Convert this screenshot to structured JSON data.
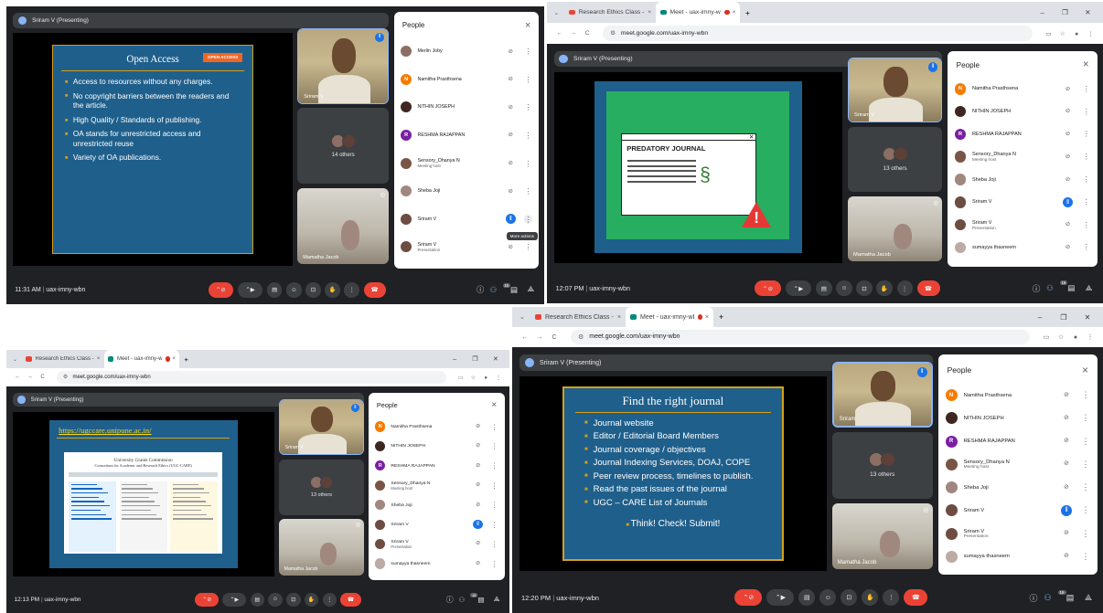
{
  "browser": {
    "tab_mail": "Research Ethics Class - mamo",
    "tab_meet": "Meet - uax-imny-wbn",
    "url": "meet.google.com/uax-imny-wbn",
    "close": "×",
    "new_tab": "+",
    "minimize": "–",
    "restore": "❐",
    "win_close": "✕",
    "back": "←",
    "forward": "→",
    "reload": "C",
    "tune": "⚙"
  },
  "meet": {
    "presenting": "Sriram V (Presenting)",
    "people_title": "People",
    "people_close": "×",
    "more_actions_tooltip": "More actions",
    "meeting_code": "uax-imny-wbn",
    "participant_count": "16"
  },
  "shots": [
    {
      "time": "11:31 AM",
      "slide": {
        "title": "Open Access",
        "logo_text": "OPEN ACCESS",
        "bullets": [
          "Access to resources without any charges.",
          "No copyright barriers between the readers and the article.",
          "High Quality / Standards of publishing.",
          "OA stands for unrestricted access and unrestricted reuse",
          "Variety of OA publications."
        ]
      },
      "tiles": {
        "speaker": "Sriram V",
        "others": "14 others",
        "third": "Mamatha Jacob"
      },
      "people": [
        {
          "name": "Merlin Joby",
          "sub": "",
          "initial": "",
          "color": "#8d6e63",
          "mic": "off"
        },
        {
          "name": "Namitha Prasthsena",
          "sub": "",
          "initial": "N",
          "color": "#f57c00",
          "mic": "off"
        },
        {
          "name": "NITHIN JOSEPH",
          "sub": "",
          "initial": "",
          "color": "#3e2723",
          "mic": "off"
        },
        {
          "name": "RESHMA RAJAPPAN",
          "sub": "",
          "initial": "R",
          "color": "#7b1fa2",
          "mic": "off"
        },
        {
          "name": "Sensory_Dhanya N",
          "sub": "Meeting host",
          "initial": "",
          "color": "#795548",
          "mic": "off"
        },
        {
          "name": "Sheba Joji",
          "sub": "",
          "initial": "",
          "color": "#a1887f",
          "mic": "off"
        },
        {
          "name": "Sriram V",
          "sub": "",
          "initial": "",
          "color": "#6d4c41",
          "mic": "on"
        },
        {
          "name": "Sriram V",
          "sub": "Presentation",
          "initial": "",
          "color": "#6d4c41",
          "mic": "off"
        }
      ]
    },
    {
      "time": "12:07 PM",
      "slide": {
        "title": "PREDATORY JOURNAL"
      },
      "tiles": {
        "speaker": "Sriram V",
        "others": "13 others",
        "third": "Mamatha Jacob"
      },
      "people": [
        {
          "name": "Namitha Prasthsena",
          "sub": "",
          "initial": "N",
          "color": "#f57c00",
          "mic": "off"
        },
        {
          "name": "NITHIN JOSEPH",
          "sub": "",
          "initial": "",
          "color": "#3e2723",
          "mic": "off"
        },
        {
          "name": "RESHMA RAJAPPAN",
          "sub": "",
          "initial": "R",
          "color": "#7b1fa2",
          "mic": "off"
        },
        {
          "name": "Sensory_Dhanya N",
          "sub": "Meeting host",
          "initial": "",
          "color": "#795548",
          "mic": "off"
        },
        {
          "name": "Sheba Joji",
          "sub": "",
          "initial": "",
          "color": "#a1887f",
          "mic": "off"
        },
        {
          "name": "Sriram V",
          "sub": "",
          "initial": "",
          "color": "#6d4c41",
          "mic": "on"
        },
        {
          "name": "Sriram V",
          "sub": "Presentation",
          "initial": "",
          "color": "#6d4c41",
          "mic": "off"
        },
        {
          "name": "sumayya thasneem",
          "sub": "",
          "initial": "",
          "color": "#bcaaa4",
          "mic": "off"
        }
      ]
    },
    {
      "time": "12:13 PM",
      "slide": {
        "title": "https://ugccare.unipune.ac.in/",
        "site_title": "University Grants Commission",
        "site_subtitle": "Consortium for Academic and Research Ethics (UGC-CARE)"
      },
      "tiles": {
        "speaker": "Sriram V",
        "others": "13 others",
        "third": "Mamatha Jacob"
      },
      "people": [
        {
          "name": "Namitha Prasthsena",
          "sub": "",
          "initial": "N",
          "color": "#f57c00",
          "mic": "off"
        },
        {
          "name": "NITHIN JOSEPH",
          "sub": "",
          "initial": "",
          "color": "#3e2723",
          "mic": "off"
        },
        {
          "name": "RESHMA RAJAPPAN",
          "sub": "",
          "initial": "R",
          "color": "#7b1fa2",
          "mic": "off"
        },
        {
          "name": "Sensory_Dhanya N",
          "sub": "Meeting host",
          "initial": "",
          "color": "#795548",
          "mic": "off"
        },
        {
          "name": "Sheba Joji",
          "sub": "",
          "initial": "",
          "color": "#a1887f",
          "mic": "off"
        },
        {
          "name": "Sriram V",
          "sub": "",
          "initial": "",
          "color": "#6d4c41",
          "mic": "on"
        },
        {
          "name": "Sriram V",
          "sub": "Presentation",
          "initial": "",
          "color": "#6d4c41",
          "mic": "off"
        },
        {
          "name": "sumayya thasneem",
          "sub": "",
          "initial": "",
          "color": "#bcaaa4",
          "mic": "off"
        }
      ]
    },
    {
      "time": "12:20 PM",
      "slide": {
        "title": "Find the right journal",
        "bullets": [
          "Journal website",
          "Editor / Editorial Board Members",
          "Journal coverage / objectives",
          "Journal Indexing Services, DOAJ, COPE",
          "Peer review process, timelines to publish.",
          "Read the past issues of the journal",
          "UGC – CARE List of Journals"
        ],
        "footer": "Think! Check! Submit!"
      },
      "tiles": {
        "speaker": "Sriram",
        "others": "13 others",
        "third": "Mamatha Jacob"
      },
      "people": [
        {
          "name": "Namitha Prasthsena",
          "sub": "",
          "initial": "N",
          "color": "#f57c00",
          "mic": "off"
        },
        {
          "name": "NITHIN JOSEPH",
          "sub": "",
          "initial": "",
          "color": "#3e2723",
          "mic": "off"
        },
        {
          "name": "RESHMA RAJAPPAN",
          "sub": "",
          "initial": "R",
          "color": "#7b1fa2",
          "mic": "off"
        },
        {
          "name": "Sensory_Dhanya N",
          "sub": "Meeting host",
          "initial": "",
          "color": "#795548",
          "mic": "off"
        },
        {
          "name": "Sheba Joji",
          "sub": "",
          "initial": "",
          "color": "#a1887f",
          "mic": "off"
        },
        {
          "name": "Sriram V",
          "sub": "",
          "initial": "",
          "color": "#6d4c41",
          "mic": "on"
        },
        {
          "name": "Sriram V",
          "sub": "Presentation",
          "initial": "",
          "color": "#6d4c41",
          "mic": "off"
        },
        {
          "name": "sumayya thasneem",
          "sub": "",
          "initial": "",
          "color": "#bcaaa4",
          "mic": "off"
        }
      ]
    }
  ]
}
